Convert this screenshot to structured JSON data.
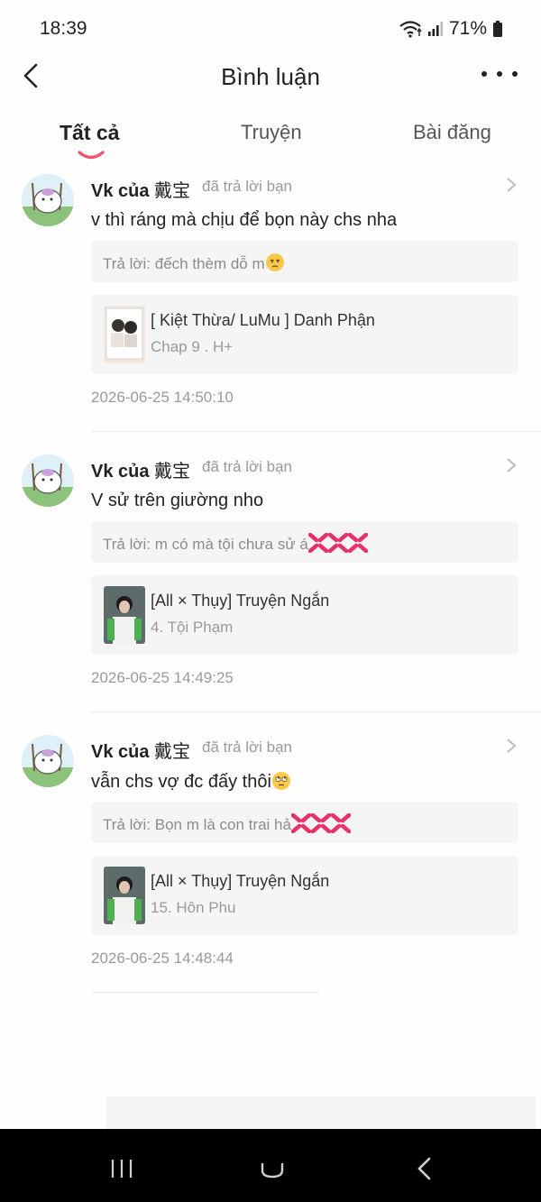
{
  "status": {
    "time": "18:39",
    "battery": "71%"
  },
  "header": {
    "title": "Bình luận"
  },
  "tabs": [
    {
      "label": "Tất cả",
      "active": true
    },
    {
      "label": "Truyện",
      "active": false
    },
    {
      "label": "Bài đăng",
      "active": false
    }
  ],
  "comments": [
    {
      "name": "Vk của",
      "name_cjk": "戴宝",
      "action": "đã trả lời bạn",
      "text": "v thì ráng mà chịu để bọn này chs nha",
      "reply": "Trả lời: đếch thèm dỗ m",
      "reply_emoji": "unamused-face",
      "story_title": "[ Kiệt Thừa/ LuMu ] Danh Phận",
      "story_chapter": "Chap 9 . H+",
      "time": "2026-06-25 14:50:10"
    },
    {
      "name": "Vk của",
      "name_cjk": "戴宝",
      "action": "đã trả lời bạn",
      "text": "V sử trên giường nho",
      "reply": "Trả lời: m có mà tội chưa sử á",
      "reply_emoji": "anger-symbol",
      "story_title": "[All × Thụy] Truyện Ngắn",
      "story_chapter": "4. Tội Phạm",
      "time": "2026-06-25 14:49:25"
    },
    {
      "name": "Vk của",
      "name_cjk": "戴宝",
      "action": "đã trả lời bạn",
      "text": "vẫn chs vợ đc đấy thôi",
      "text_emoji": "eye-roll-face",
      "reply": "Trả lời: Bọn m là con trai hả",
      "reply_emoji": "anger-symbol",
      "story_title": "[All × Thụy] Truyện Ngắn",
      "story_chapter": "15. Hôn Phu",
      "time": "2026-06-25 14:48:44"
    }
  ],
  "colors": {
    "tab_indicator": "#f2546b",
    "anger": "#e8306a"
  }
}
